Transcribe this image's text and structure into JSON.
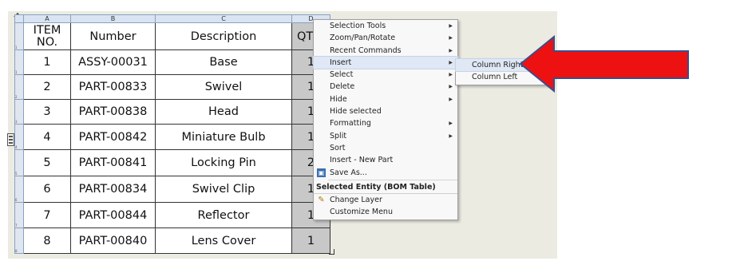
{
  "table": {
    "col_letters": [
      "A",
      "B",
      "C",
      "D"
    ],
    "headers": {
      "item_no": "ITEM\nNO.",
      "number": "Number",
      "description": "Description",
      "qty": "QT"
    },
    "rows": [
      {
        "rownum": "1",
        "item": "1",
        "number": "ASSY-00031",
        "description": "Base",
        "qty": "1"
      },
      {
        "rownum": "2",
        "item": "2",
        "number": "PART-00833",
        "description": "Swivel",
        "qty": "1"
      },
      {
        "rownum": "3",
        "item": "3",
        "number": "PART-00838",
        "description": "Head",
        "qty": "1"
      },
      {
        "rownum": "4",
        "item": "4",
        "number": "PART-00842",
        "description": "Miniature Bulb",
        "qty": "1"
      },
      {
        "rownum": "5",
        "item": "5",
        "number": "PART-00841",
        "description": "Locking Pin",
        "qty": "2"
      },
      {
        "rownum": "6",
        "item": "6",
        "number": "PART-00834",
        "description": "Swivel Clip",
        "qty": "1"
      },
      {
        "rownum": "7",
        "item": "7",
        "number": "PART-00844",
        "description": "Reflector",
        "qty": "1"
      },
      {
        "rownum": "8",
        "item": "8",
        "number": "PART-00840",
        "description": "Lens Cover",
        "qty": "1"
      }
    ],
    "header_rownum": "1"
  },
  "context_menu": {
    "items": [
      {
        "label": "Selection Tools",
        "submenu": true
      },
      {
        "label": "Zoom/Pan/Rotate",
        "submenu": true
      },
      {
        "label": "Recent Commands",
        "submenu": true
      },
      {
        "label": "Insert",
        "submenu": true
      },
      {
        "label": "Select",
        "submenu": true
      },
      {
        "label": "Delete",
        "submenu": true
      },
      {
        "label": "Hide",
        "submenu": true
      },
      {
        "label": "Hide selected",
        "submenu": false
      },
      {
        "label": "Formatting",
        "submenu": true
      },
      {
        "label": "Split",
        "submenu": true
      },
      {
        "label": "Sort",
        "submenu": false
      },
      {
        "label": "Insert - New Part",
        "submenu": false
      },
      {
        "label": "Save As...",
        "submenu": false
      }
    ],
    "section_label": "Selected Entity (BOM Table)",
    "section_items": [
      {
        "label": "Change Layer"
      },
      {
        "label": "Customize Menu"
      }
    ]
  },
  "insert_submenu": {
    "items": [
      "Column Right",
      "Column Left"
    ]
  },
  "colors": {
    "canvas_bg": "#ecebe2",
    "qty_column": "#c8c8c8",
    "arrow_red": "#ee1111",
    "arrow_outline": "#3a4e8c",
    "menu_highlight": "#dfe8f4"
  },
  "icons": {
    "move_handle": "move-cross-icon",
    "save_as": "save-disk-icon",
    "change_layer": "layer-pencil-icon",
    "submenu_arrow": "chevron-right-icon"
  }
}
